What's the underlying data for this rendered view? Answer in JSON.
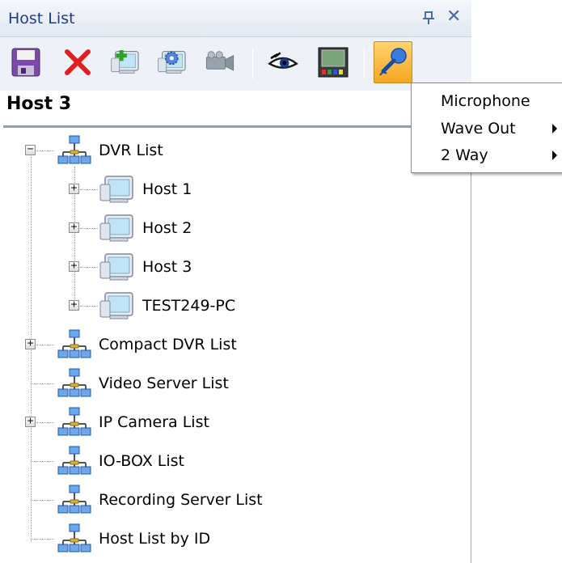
{
  "window": {
    "title": "Host List",
    "pin_icon": "pin-icon",
    "close_glyph": "✕"
  },
  "toolbar": {
    "buttons": [
      {
        "name": "save",
        "icon": "save-icon"
      },
      {
        "name": "delete",
        "icon": "delete-icon"
      },
      {
        "name": "add-host",
        "icon": "add-monitor-icon"
      },
      {
        "name": "settings",
        "icon": "gear-monitor-icon"
      },
      {
        "name": "camera",
        "icon": "video-camera-icon"
      },
      {
        "name": "view",
        "icon": "eye-icon"
      },
      {
        "name": "display",
        "icon": "display-screen-icon"
      },
      {
        "name": "microphone",
        "icon": "microphone-icon",
        "active": true
      }
    ]
  },
  "selected_host": "Host 3",
  "tree": {
    "root": {
      "label": "DVR List",
      "expander": "⊟"
    },
    "hosts": [
      {
        "label": "Host 1"
      },
      {
        "label": "Host 2"
      },
      {
        "label": "Host 3"
      },
      {
        "label": "TEST249-PC"
      }
    ],
    "groups": [
      {
        "label": "Compact DVR List",
        "expandable": true
      },
      {
        "label": "Video Server List",
        "expandable": false
      },
      {
        "label": "IP Camera List",
        "expandable": true
      },
      {
        "label": "IO-BOX List",
        "expandable": false
      },
      {
        "label": "Recording Server List",
        "expandable": false
      },
      {
        "label": "Host List by ID",
        "expandable": false
      }
    ]
  },
  "context_menu": {
    "items": [
      {
        "label": "Microphone",
        "submenu": false
      },
      {
        "label": "Wave Out",
        "submenu": true
      },
      {
        "label": "2 Way",
        "submenu": true
      }
    ]
  },
  "colors": {
    "accent": "#f5a623",
    "title_text": "#1e3c8c",
    "toolbar_bg": "#eef2f8"
  }
}
